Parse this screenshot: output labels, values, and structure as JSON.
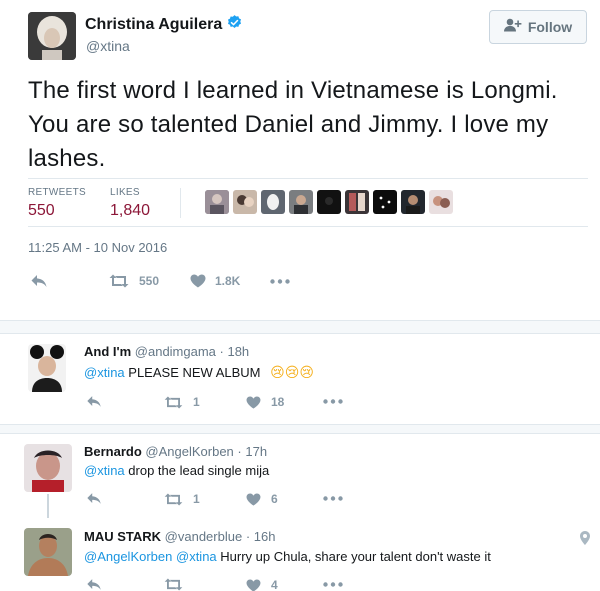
{
  "tweet": {
    "author_name": "Christina Aguilera",
    "author_handle": "@xtina",
    "follow_label": "Follow",
    "text": "The first word I learned in Vietnamese is Longmi. You are so talented Daniel and Jimmy. I love my lashes.",
    "stats": {
      "retweets_label": "RETWEETS",
      "retweets_value": "550",
      "likes_label": "LIKES",
      "likes_value": "1,840"
    },
    "timestamp": "11:25 AM - 10 Nov 2016",
    "actions": {
      "retweet_count": "550",
      "like_count": "1.8K"
    }
  },
  "replies": [
    {
      "name": "And I'm",
      "handle": "@andimgama",
      "time": "· 18h",
      "mention": "@xtina",
      "text": " PLEASE NEW ALBUM",
      "emoji": "😢😢😢",
      "retweets": "1",
      "likes": "18"
    },
    {
      "name": "Bernardo",
      "handle": "@AngelKorben",
      "time": "· 17h",
      "mention": "@xtina",
      "text": " drop the lead single mija",
      "retweets": "1",
      "likes": "6"
    },
    {
      "name": "MAU STARK",
      "handle": "@vanderblue",
      "time": "· 16h",
      "mention1": "@AngelKorben",
      "mention2": "@xtina",
      "text": " Hurry up Chula, share your talent don't waste it",
      "retweets": "",
      "likes": "4"
    }
  ],
  "colors": {
    "link": "#1b95e0",
    "verified": "#1da1f2",
    "muted": "#657786",
    "stat_value": "#8c1738",
    "icon": "#8899a6",
    "divider": "#e6ecf0"
  },
  "icons": [
    "verified-badge-icon",
    "add-user-icon",
    "reply-icon",
    "retweet-icon",
    "heart-icon",
    "more-icon",
    "location-pin-icon"
  ]
}
